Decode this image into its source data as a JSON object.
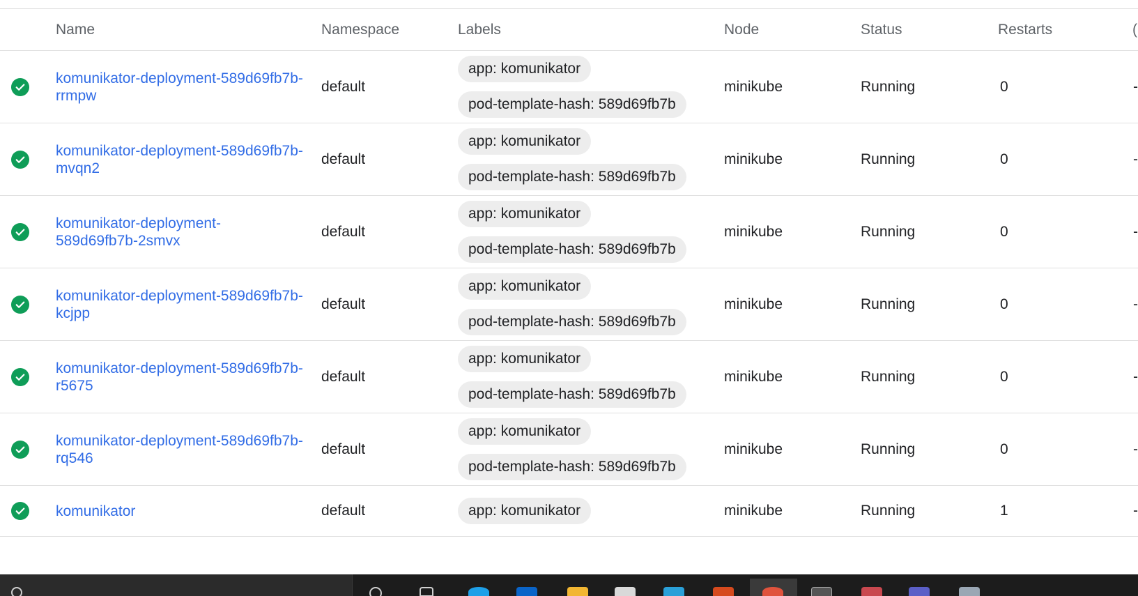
{
  "table": {
    "columns": {
      "name": "Name",
      "namespace": "Namespace",
      "labels": "Labels",
      "node": "Node",
      "status": "Status",
      "restarts": "Restarts",
      "cut": "("
    },
    "rows": [
      {
        "name": "komunikator-deployment-589d69fb7b-\nrrmpw",
        "namespace": "default",
        "labels": [
          "app: komunikator",
          "pod-template-hash: 589d69fb7b"
        ],
        "node": "minikube",
        "status": "Running",
        "restarts": "0",
        "extra": "-"
      },
      {
        "name": "komunikator-deployment-589d69fb7b-\nmvqn2",
        "namespace": "default",
        "labels": [
          "app: komunikator",
          "pod-template-hash: 589d69fb7b"
        ],
        "node": "minikube",
        "status": "Running",
        "restarts": "0",
        "extra": "-"
      },
      {
        "name": "komunikator-deployment-\n589d69fb7b-2smvx",
        "namespace": "default",
        "labels": [
          "app: komunikator",
          "pod-template-hash: 589d69fb7b"
        ],
        "node": "minikube",
        "status": "Running",
        "restarts": "0",
        "extra": "-"
      },
      {
        "name": "komunikator-deployment-589d69fb7b-\nkcjpp",
        "namespace": "default",
        "labels": [
          "app: komunikator",
          "pod-template-hash: 589d69fb7b"
        ],
        "node": "minikube",
        "status": "Running",
        "restarts": "0",
        "extra": "-"
      },
      {
        "name": "komunikator-deployment-589d69fb7b-\nr5675",
        "namespace": "default",
        "labels": [
          "app: komunikator",
          "pod-template-hash: 589d69fb7b"
        ],
        "node": "minikube",
        "status": "Running",
        "restarts": "0",
        "extra": "-"
      },
      {
        "name": "komunikator-deployment-589d69fb7b-\nrq546",
        "namespace": "default",
        "labels": [
          "app: komunikator",
          "pod-template-hash: 589d69fb7b"
        ],
        "node": "minikube",
        "status": "Running",
        "restarts": "0",
        "extra": "-"
      },
      {
        "name": "komunikator",
        "namespace": "default",
        "labels": [
          "app: komunikator"
        ],
        "node": "minikube",
        "status": "Running",
        "restarts": "1",
        "extra": "-"
      }
    ]
  },
  "icons": {
    "status": "check-circle-icon",
    "status_color": "#0f9d58",
    "link_color": "#326de6"
  },
  "taskbar": {
    "apps": [
      "search-icon",
      "task-view-icon",
      "edge-browser-icon",
      "mail-icon",
      "file-explorer-icon",
      "store-icon",
      "app-icon",
      "office-icon",
      "chrome-icon",
      "terminal-icon",
      "tools-icon",
      "teams-icon",
      "files-icon"
    ]
  }
}
